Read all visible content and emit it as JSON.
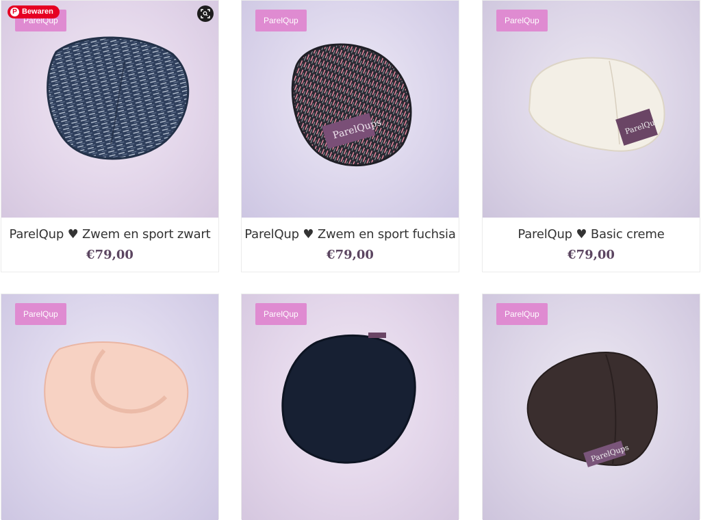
{
  "pinterest": {
    "save_label": "Bewaren",
    "logo_glyph": "P",
    "icon": "pinterest-icon"
  },
  "lens": {
    "icon": "visual-search-icon"
  },
  "products": [
    {
      "badge": "ParelQup",
      "title": "ParelQup ♥ Zwem en sport zwart",
      "price": "€79,00"
    },
    {
      "badge": "ParelQup",
      "title": "ParelQup ♥ Zwem en sport fuchsia",
      "price": "€79,00"
    },
    {
      "badge": "ParelQup",
      "title": "ParelQup ♥ Basic creme",
      "price": "€79,00"
    },
    {
      "badge": "ParelQup",
      "title": "",
      "price": ""
    },
    {
      "badge": "ParelQup",
      "title": "",
      "price": ""
    },
    {
      "badge": "ParelQup",
      "title": "",
      "price": ""
    }
  ],
  "colors": {
    "badge": "#df8bd1",
    "price": "#5b4560",
    "pinterest": "#e60023"
  }
}
